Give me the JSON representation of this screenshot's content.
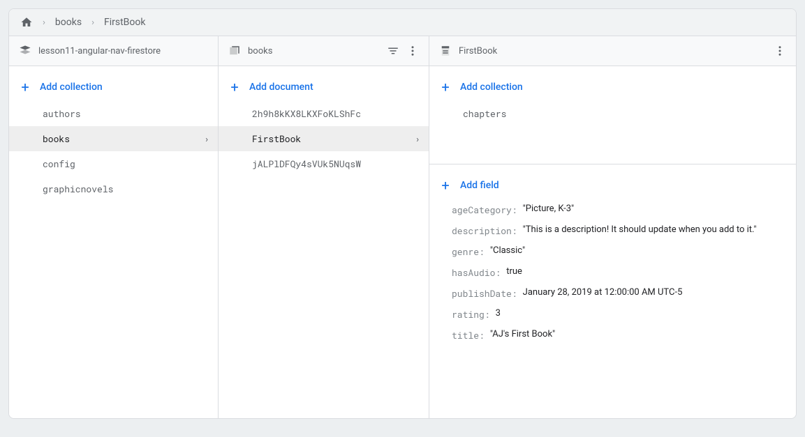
{
  "breadcrumb": {
    "items": [
      "books",
      "FirstBook"
    ]
  },
  "columns": {
    "root": {
      "title": "lesson11-angular-nav-firestore",
      "addLabel": "Add collection",
      "collections": [
        {
          "name": "authors",
          "selected": false
        },
        {
          "name": "books",
          "selected": true
        },
        {
          "name": "config",
          "selected": false
        },
        {
          "name": "graphicnovels",
          "selected": false
        }
      ]
    },
    "collection": {
      "title": "books",
      "addLabel": "Add document",
      "documents": [
        {
          "name": "2h9h8kKX8LKXFoKLShFc",
          "selected": false
        },
        {
          "name": "FirstBook",
          "selected": true
        },
        {
          "name": "jALPlDFQy4sVUk5NUqsW",
          "selected": false
        }
      ]
    },
    "document": {
      "title": "FirstBook",
      "addCollectionLabel": "Add collection",
      "subcollections": [
        {
          "name": "chapters"
        }
      ],
      "addFieldLabel": "Add field",
      "fields": [
        {
          "key": "ageCategory",
          "value": "\"Picture, K-3\""
        },
        {
          "key": "description",
          "value": "\"This is a description! It should update when you add to it.\""
        },
        {
          "key": "genre",
          "value": "\"Classic\""
        },
        {
          "key": "hasAudio",
          "value": "true"
        },
        {
          "key": "publishDate",
          "value": "January 28, 2019 at 12:00:00 AM UTC-5"
        },
        {
          "key": "rating",
          "value": "3"
        },
        {
          "key": "title",
          "value": "\"AJ's First Book\""
        }
      ]
    }
  }
}
